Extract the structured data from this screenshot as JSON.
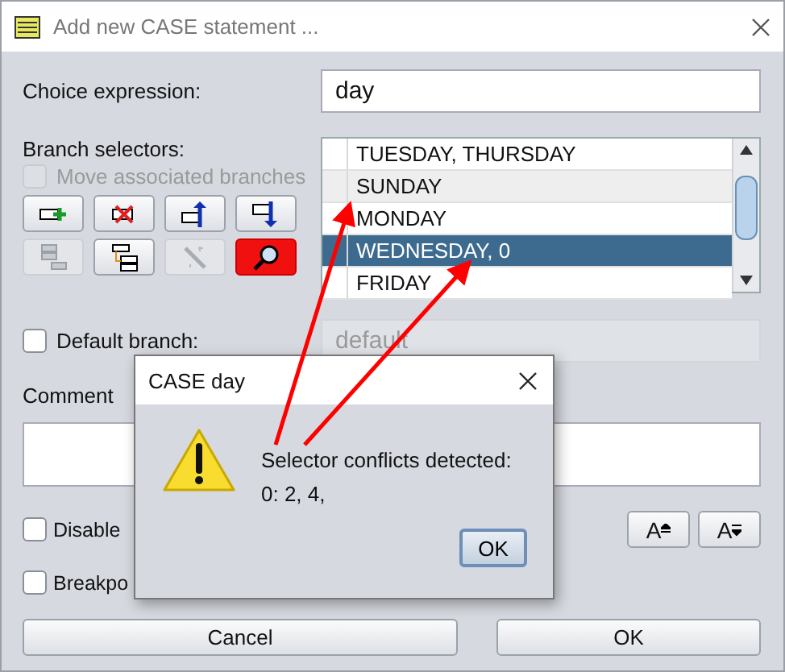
{
  "window": {
    "title": "Add new CASE statement ..."
  },
  "choice_expression": {
    "label": "Choice expression:",
    "value": "day"
  },
  "branch_selectors": {
    "label": "Branch selectors:",
    "move_associated": {
      "label": "Move associated branches",
      "checked": false,
      "disabled": true
    },
    "tool_buttons": [
      {
        "kind": "add",
        "disabled": false,
        "active": false
      },
      {
        "kind": "delete",
        "disabled": false,
        "active": false
      },
      {
        "kind": "up",
        "disabled": false,
        "active": false
      },
      {
        "kind": "down",
        "disabled": false,
        "active": false
      },
      {
        "kind": "collapse",
        "disabled": true,
        "active": false
      },
      {
        "kind": "expand",
        "disabled": false,
        "active": false
      },
      {
        "kind": "wand",
        "disabled": true,
        "active": false
      },
      {
        "kind": "search",
        "disabled": false,
        "active": true
      }
    ],
    "items": [
      {
        "text": "TUESDAY, THURSDAY",
        "selected": false,
        "highlighted": false
      },
      {
        "text": "SUNDAY",
        "selected": false,
        "highlighted": true
      },
      {
        "text": "MONDAY",
        "selected": false,
        "highlighted": false
      },
      {
        "text": "WEDNESDAY, 0",
        "selected": true,
        "highlighted": false
      },
      {
        "text": "FRIDAY",
        "selected": false,
        "highlighted": false
      }
    ]
  },
  "default_branch": {
    "label": "Default branch:",
    "checked": false,
    "value": "default",
    "disabled": true
  },
  "comment": {
    "label": "Comment"
  },
  "options": [
    {
      "label": "Disable",
      "checked": false
    },
    {
      "label": "Breakpo",
      "checked": false
    }
  ],
  "font_buttons": [
    {
      "label": "A",
      "kind": "increase"
    },
    {
      "label": "A",
      "kind": "decrease"
    }
  ],
  "buttons": [
    "Cancel",
    "OK"
  ],
  "message": {
    "title": "CASE day",
    "lines": [
      "Selector conflicts detected:",
      "0: 2, 4,"
    ],
    "button": "OK"
  }
}
